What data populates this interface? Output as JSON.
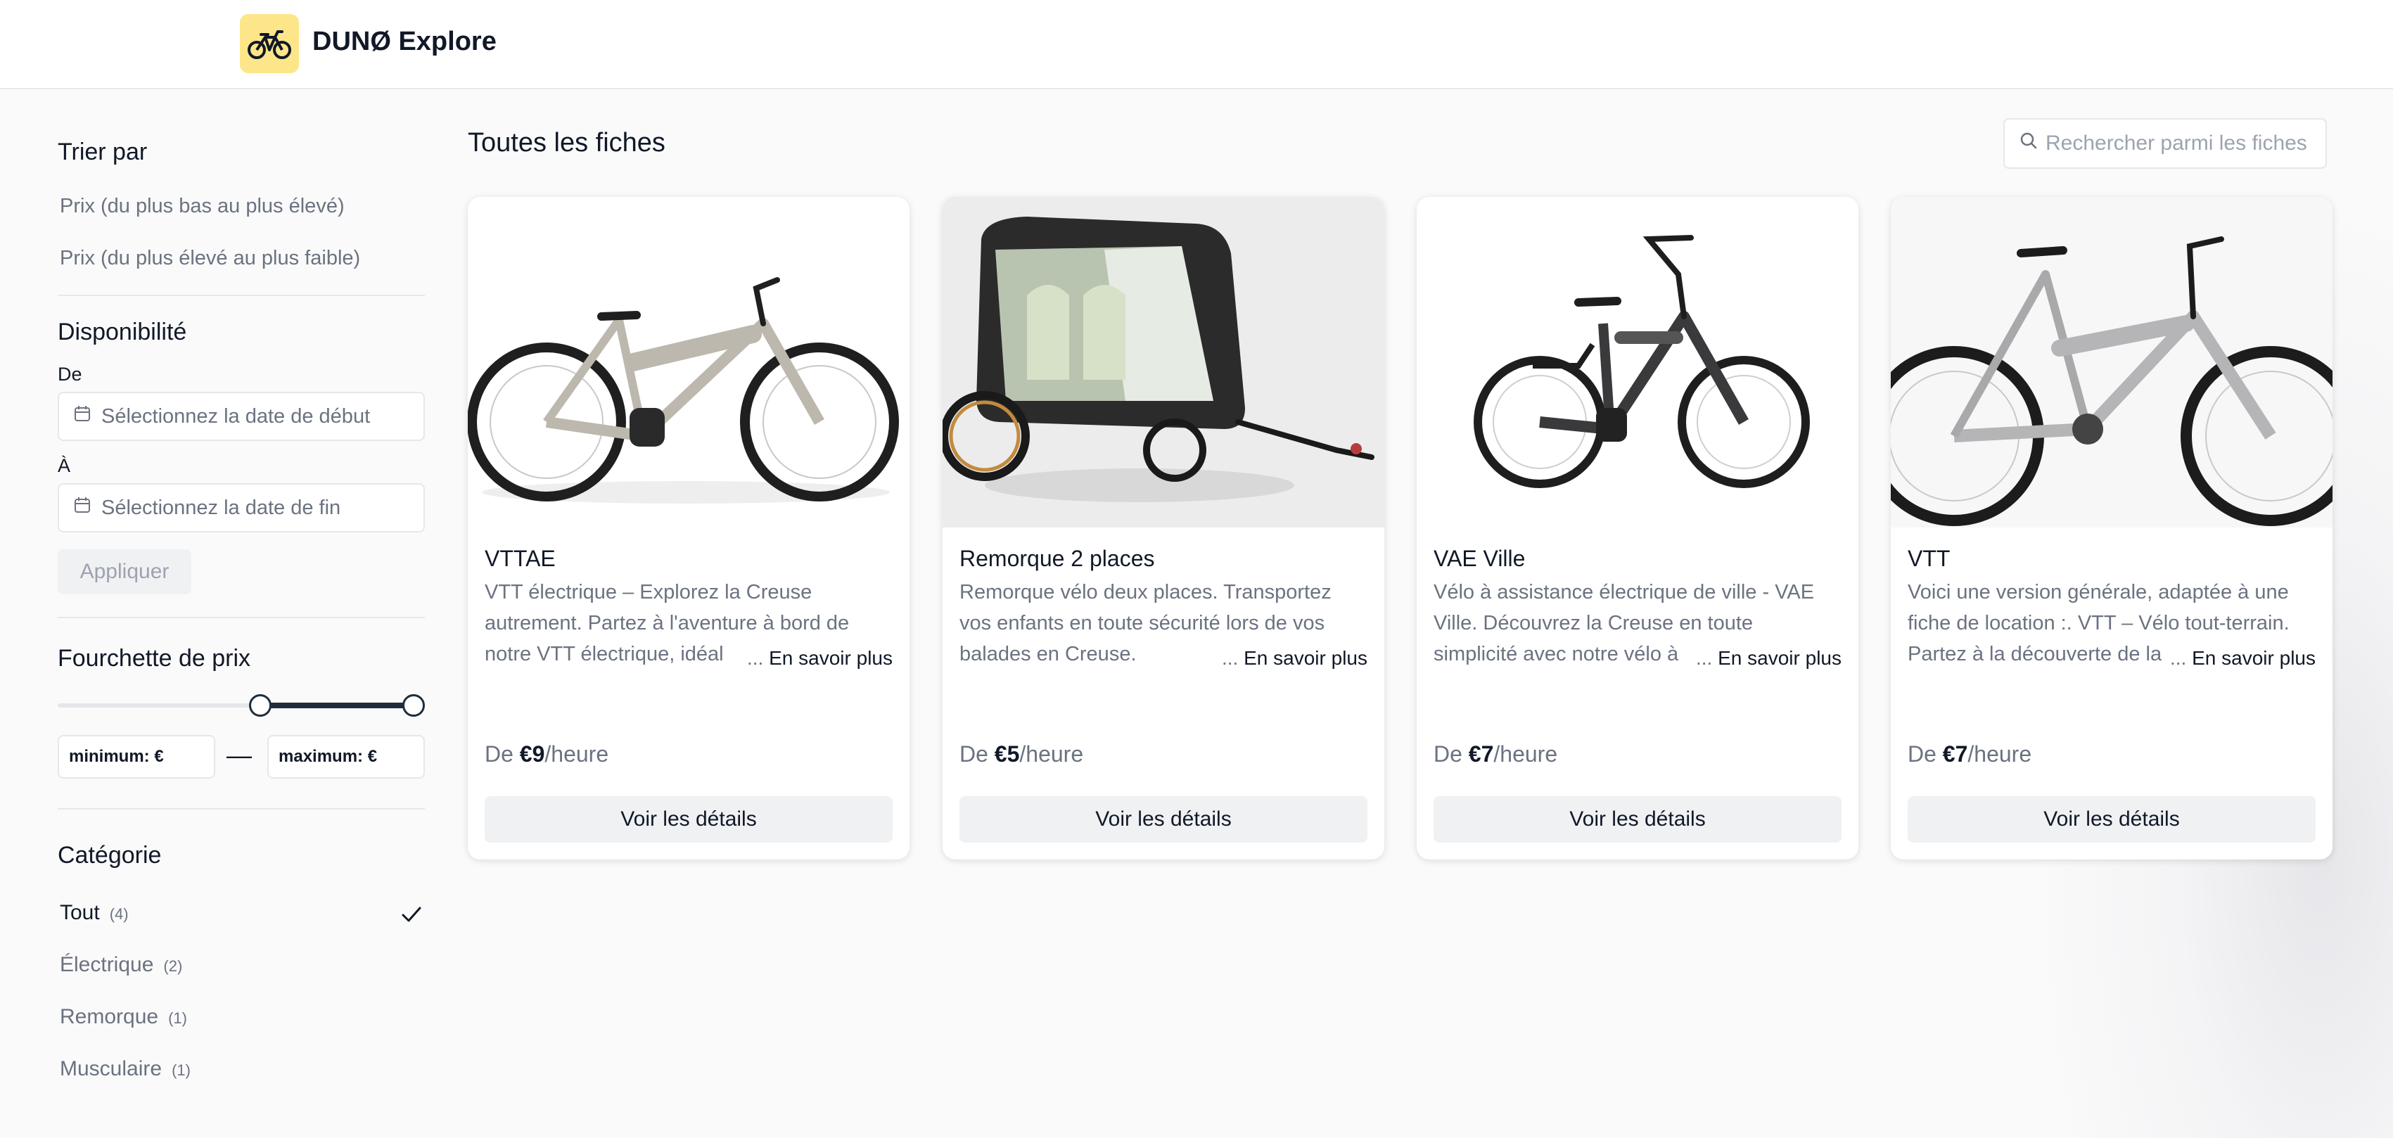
{
  "app": {
    "brand": "DUNØ Explore",
    "accent": "#fde68a",
    "dark": "#1f2d3d"
  },
  "sidebar": {
    "sort": {
      "title": "Trier par",
      "options": [
        "Prix (du plus bas au plus élevé)",
        "Prix (du plus élevé au plus faible)"
      ]
    },
    "availability": {
      "title": "Disponibilité",
      "from_label": "De",
      "from_placeholder": "Sélectionnez la date de début",
      "to_label": "À",
      "to_placeholder": "Sélectionnez la date de fin",
      "apply_label": "Appliquer"
    },
    "price": {
      "title": "Fourchette de prix",
      "min_placeholder": "minimum: €",
      "max_placeholder": "maximum: €",
      "dash": "—",
      "range_low_fraction": 0.57,
      "range_high_fraction": 1.0
    },
    "category": {
      "title": "Catégorie",
      "items": [
        {
          "label": "Tout",
          "count": "(4)",
          "selected": true
        },
        {
          "label": "Électrique",
          "count": "(2)",
          "selected": false
        },
        {
          "label": "Remorque",
          "count": "(1)",
          "selected": false
        },
        {
          "label": "Musculaire",
          "count": "(1)",
          "selected": false
        }
      ]
    }
  },
  "main": {
    "title": "Toutes les fiches",
    "search_placeholder": "Rechercher parmi les fiches",
    "more_ellipsis": "...",
    "cards": [
      {
        "title": "VTTAE",
        "description": "VTT électrique – Explorez la Creuse autrement. Partez à l'aventure à bord de notre VTT électrique, idéal",
        "more_label": "En savoir plus",
        "price_prefix": "De",
        "price": "€9",
        "price_unit": "/heure",
        "button_label": "Voir les détails"
      },
      {
        "title": "Remorque 2 places",
        "description": "Remorque vélo deux places. Transportez vos enfants en toute sécurité lors de vos balades en Creuse.",
        "more_label": "En savoir plus",
        "price_prefix": "De",
        "price": "€5",
        "price_unit": "/heure",
        "button_label": "Voir les détails"
      },
      {
        "title": "VAE Ville",
        "description": "Vélo à assistance électrique de ville - VAE Ville. Découvrez la Creuse en toute simplicité avec notre vélo à",
        "more_label": "En savoir plus",
        "price_prefix": "De",
        "price": "€7",
        "price_unit": "/heure",
        "button_label": "Voir les détails"
      },
      {
        "title": "VTT",
        "description": "Voici une version générale, adaptée à une fiche de location :. VTT – Vélo tout-terrain. Partez à la découverte de la",
        "more_label": "En savoir plus",
        "price_prefix": "De",
        "price": "€7",
        "price_unit": "/heure",
        "button_label": "Voir les détails"
      }
    ]
  }
}
